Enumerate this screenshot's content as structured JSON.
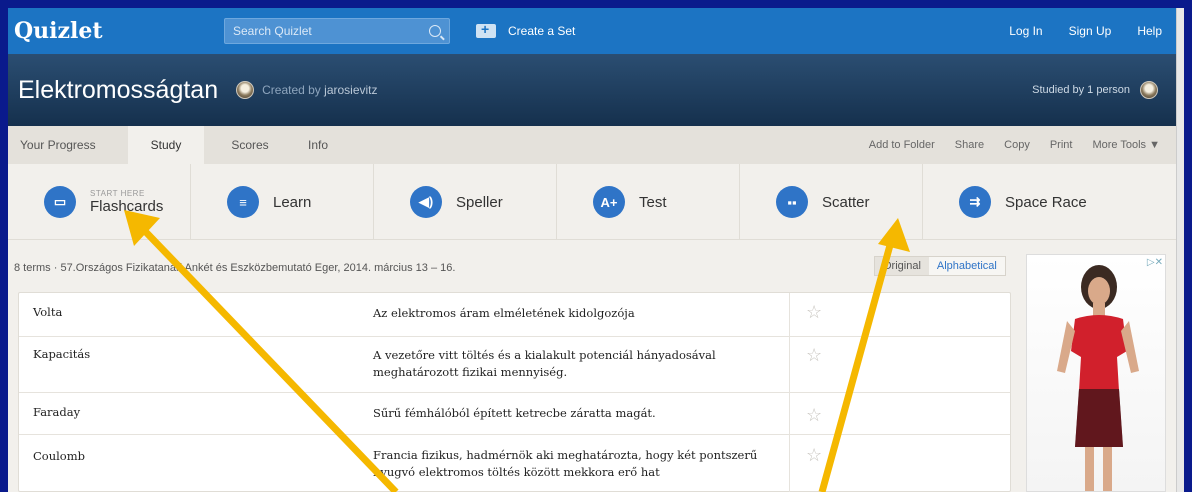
{
  "topbar": {
    "logo": "Quizlet",
    "search_placeholder": "Search Quizlet",
    "create_label": "Create a Set",
    "links": [
      "Log In",
      "Sign Up",
      "Help"
    ]
  },
  "header": {
    "title": "Elektromosságtan",
    "created_prefix": "Created by",
    "creator": "jarosievitz",
    "studied": "Studied by 1 person"
  },
  "tabs": {
    "progress": "Your Progress",
    "study": "Study",
    "scores": "Scores",
    "info": "Info",
    "tools": [
      "Add to Folder",
      "Share",
      "Copy",
      "Print",
      "More Tools ▼"
    ]
  },
  "modes": [
    {
      "name": "Flashcards",
      "sub": "START HERE",
      "icon": "flashcards-icon",
      "glyph": "▭"
    },
    {
      "name": "Learn",
      "sub": "",
      "icon": "learn-icon",
      "glyph": "≡"
    },
    {
      "name": "Speller",
      "sub": "",
      "icon": "speaker-icon",
      "glyph": "◀)"
    },
    {
      "name": "Test",
      "sub": "",
      "icon": "test-icon",
      "glyph": "A+"
    },
    {
      "name": "Scatter",
      "sub": "",
      "icon": "scatter-icon",
      "glyph": "▪▪"
    },
    {
      "name": "Space Race",
      "sub": "",
      "icon": "space-race-icon",
      "glyph": "⇉"
    }
  ],
  "meta": "8 terms · 57.Országos Fizikatanári Ankét és Eszközbemutató Eger, 2014. március 13 – 16.",
  "sort": {
    "original": "Original",
    "alphabetical": "Alphabetical"
  },
  "terms": [
    {
      "term": "Volta",
      "definition": "Az elektromos áram elméletének kidolgozója"
    },
    {
      "term": "Kapacitás",
      "definition": "A vezetőre vitt töltés és a kialakult potenciál hányadosával meghatározott fizikai mennyiség."
    },
    {
      "term": "Faraday",
      "definition": "Sűrű fémhálóból épített ketrecbe záratta magát."
    },
    {
      "term": "Coulomb",
      "definition": "Francia fizikus, hadmérnök aki meghatározta, hogy két pontszerű nyugvó elektromos töltés között mekkora erő hat"
    }
  ],
  "colors": {
    "accent": "#1c74c3",
    "arrow": "#f5b800",
    "background": "#0a1a8c"
  }
}
